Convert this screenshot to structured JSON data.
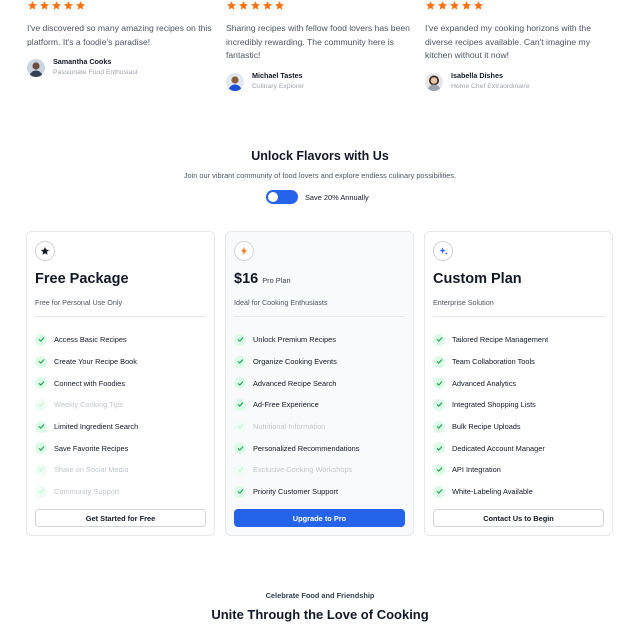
{
  "colors": {
    "accent": "#2563eb",
    "star": "#f97316",
    "check_bg": "#dcfce7",
    "check": "#16a34a"
  },
  "testimonials": [
    {
      "rating": 5,
      "quote": "I've discovered so many amazing recipes on this platform. It's a foodie's paradise!",
      "name": "Samantha Cooks",
      "role": "Passionate Food Enthusiast",
      "avatar_icon": "avatar-photo"
    },
    {
      "rating": 5,
      "quote": "Sharing recipes with fellow food lovers has been incredibly rewarding. The community here is fantastic!",
      "name": "Michael Tastes",
      "role": "Culinary Explorer",
      "avatar_icon": "avatar-photo"
    },
    {
      "rating": 5,
      "quote": "I've expanded my cooking horizons with the diverse recipes available. Can't imagine my kitchen without it now!",
      "name": "Isabella Dishes",
      "role": "Home Chef Extraordinaire",
      "avatar_icon": "avatar-photo"
    }
  ],
  "pricing": {
    "title": "Unlock Flavors with Us",
    "subtitle": "Join our vibrant community of food lovers and explore endless culinary possibilities.",
    "billing_toggle_label": "Save 20% Annually",
    "billing_toggle_on": true,
    "plans": [
      {
        "icon": "star-icon",
        "name": "Free Package",
        "price_suffix": "",
        "description": "Free for Personal Use Only",
        "features": [
          {
            "label": "Access Basic Recipes",
            "included": true
          },
          {
            "label": "Create Your Recipe Book",
            "included": true
          },
          {
            "label": "Connect with Foodies",
            "included": true
          },
          {
            "label": "Weekly Cooking Tips",
            "included": false
          },
          {
            "label": "Limited Ingredient Search",
            "included": true
          },
          {
            "label": "Save Favorite Recipes",
            "included": true
          },
          {
            "label": "Share on Social Media",
            "included": false
          },
          {
            "label": "Community Support",
            "included": false
          }
        ],
        "button": "Get Started for Free",
        "primary": false
      },
      {
        "icon": "lightning-icon",
        "name": "$16",
        "price_suffix": "Pro Plan",
        "description": "Ideal for Cooking Enthusiasts",
        "features": [
          {
            "label": "Unlock Premium Recipes",
            "included": true
          },
          {
            "label": "Organize Cooking Events",
            "included": true
          },
          {
            "label": "Advanced Recipe Search",
            "included": true
          },
          {
            "label": "Ad-Free Experience",
            "included": true
          },
          {
            "label": "Nutritional Information",
            "included": false
          },
          {
            "label": "Personalized Recommendations",
            "included": true
          },
          {
            "label": "Exclusive Cooking Workshops",
            "included": false
          },
          {
            "label": "Priority Customer Support",
            "included": true
          }
        ],
        "button": "Upgrade to Pro",
        "primary": true
      },
      {
        "icon": "sparkle-icon",
        "name": "Custom Plan",
        "price_suffix": "",
        "description": "Enterprise Solution",
        "features": [
          {
            "label": "Tailored Recipe Management",
            "included": true
          },
          {
            "label": "Team Collaboration Tools",
            "included": true
          },
          {
            "label": "Advanced Analytics",
            "included": true
          },
          {
            "label": "Integrated Shopping Lists",
            "included": true
          },
          {
            "label": "Bulk Recipe Uploads",
            "included": true
          },
          {
            "label": "Dedicated Account Manager",
            "included": true
          },
          {
            "label": "API Integration",
            "included": true
          },
          {
            "label": "White-Labeling Available",
            "included": true
          }
        ],
        "button": "Contact Us to Begin",
        "primary": false
      }
    ]
  },
  "community": {
    "eyebrow": "Celebrate Food and Friendship",
    "title": "Unite Through the Love of Cooking"
  }
}
